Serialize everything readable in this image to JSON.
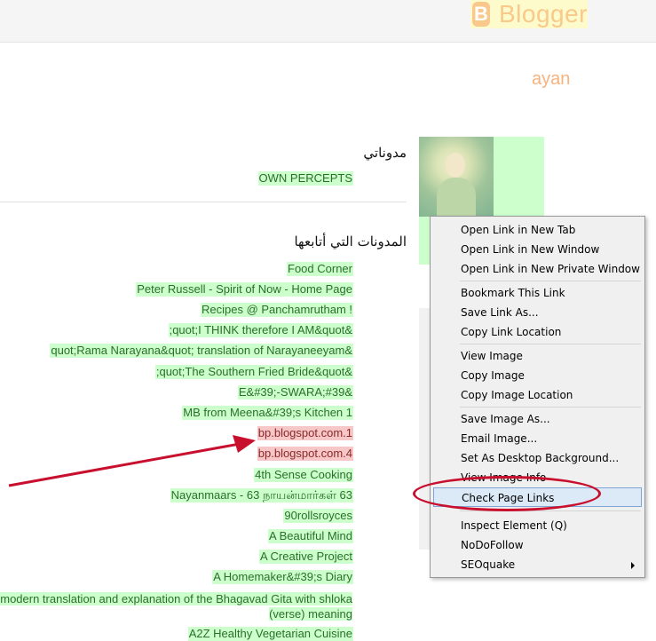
{
  "header": {
    "logo_text": "Blogger",
    "logo_icon": "blogger-b-icon"
  },
  "profile": {
    "name_fragment": "ayan",
    "avatar": "krishna-flute-image"
  },
  "my_blogs": {
    "heading": "مدوناتي",
    "items": [
      "OWN PERCEPTS"
    ]
  },
  "followed_blogs": {
    "heading": "المدونات التي أتابعها",
    "items": [
      "Food Corner",
      "Peter Russell - Spirit of Now - Home Page",
      "Recipes @ Panchamrutham !",
      ";quot;I THINK therefore I AM&quot&",
      "quot;Rama Narayana&quot; translation of Narayaneeyam&",
      ";quot;The Southern Fried Bride&quot&",
      "E&#39;-SWARA;#39&",
      "MB from Meena&#39;s Kitchen 1",
      "bp.blogspot.com.1",
      "bp.blogspot.com.4",
      "4th Sense Cooking",
      "Nayanmaars - 63 நாயன்மார்கள் 63",
      "90rollsroyces",
      "A Beautiful Mind",
      "A Creative Project",
      "A Homemaker&#39;s Diary",
      "modern translation and explanation of the Bhagavad Gita with shloka (verse) meaning",
      "A2Z Healthy Vegetarian Cuisine"
    ]
  },
  "context_menu": {
    "items": [
      {
        "label": "Open Link in New Tab"
      },
      {
        "label": "Open Link in New Window"
      },
      {
        "label": "Open Link in New Private Window"
      },
      {
        "label": "Bookmark This Link"
      },
      {
        "label": "Save Link As..."
      },
      {
        "label": "Copy Link Location"
      },
      {
        "label": "View Image"
      },
      {
        "label": "Copy Image"
      },
      {
        "label": "Copy Image Location"
      },
      {
        "label": "Save Image As..."
      },
      {
        "label": "Email Image..."
      },
      {
        "label": "Set As Desktop Background..."
      },
      {
        "label": "View Image Info"
      },
      {
        "label": "Check Page Links"
      },
      {
        "label": "Inspect Element (Q)"
      },
      {
        "label": "NoDoFollow"
      },
      {
        "label": "SEOquake"
      }
    ],
    "highlighted": "Check Page Links"
  },
  "colors": {
    "link_highlight": "#ccffcc",
    "broken_link_highlight": "#f7c6c6",
    "annotation_red": "#c8102e",
    "menu_highlight": "#dceaf8"
  }
}
